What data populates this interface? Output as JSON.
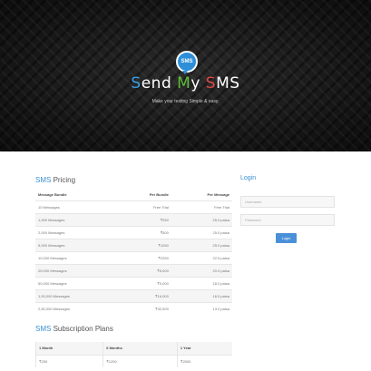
{
  "hero": {
    "logo_text": "SMS",
    "brand": {
      "letter1": "S",
      "rest1": "end ",
      "letter2": "M",
      "rest2": "y ",
      "letter3": "S",
      "rest3": "MS"
    },
    "tagline": "Make your texting Simple & easy.",
    "colors": {
      "blue": "#3aa0e8",
      "green": "#5fbf3a",
      "red": "#e04848"
    }
  },
  "pricing": {
    "title_highlight": "SMS",
    "title_rest": " Pricing",
    "headers": [
      "Message Bundle",
      "Per Bundle",
      "Per Message"
    ],
    "rows": [
      [
        "10 Messages",
        "Free Trial",
        "Free Trial"
      ],
      [
        "1,000 Messages",
        "₹250",
        "25.0 paisa"
      ],
      [
        "2,000 Messages",
        "₹500",
        "25.0 paisa"
      ],
      [
        "5,000 Messages",
        "₹1250",
        "25.0 paisa"
      ],
      [
        "10,000 Messages",
        "₹2250",
        "22.5 paisa"
      ],
      [
        "25,000 Messages",
        "₹5,000",
        "20.0 paisa"
      ],
      [
        "50,000 Messages",
        "₹9,000",
        "18.0 paisa"
      ],
      [
        "1,00,000 Messages",
        "₹16,000",
        "16.0 paisa"
      ],
      [
        "2,50,000 Messages",
        "₹32,500",
        "13.0 paisa"
      ]
    ]
  },
  "plans": {
    "title_highlight": "SMS",
    "title_rest": " Subscription Plans",
    "headers": [
      "1 Month",
      "6 Months",
      "1 Year"
    ],
    "row": [
      "₹250",
      "₹1250",
      "₹2500"
    ]
  },
  "login": {
    "title": "Login",
    "username_placeholder": "Username",
    "password_placeholder": "Password",
    "button_label": "Login"
  }
}
